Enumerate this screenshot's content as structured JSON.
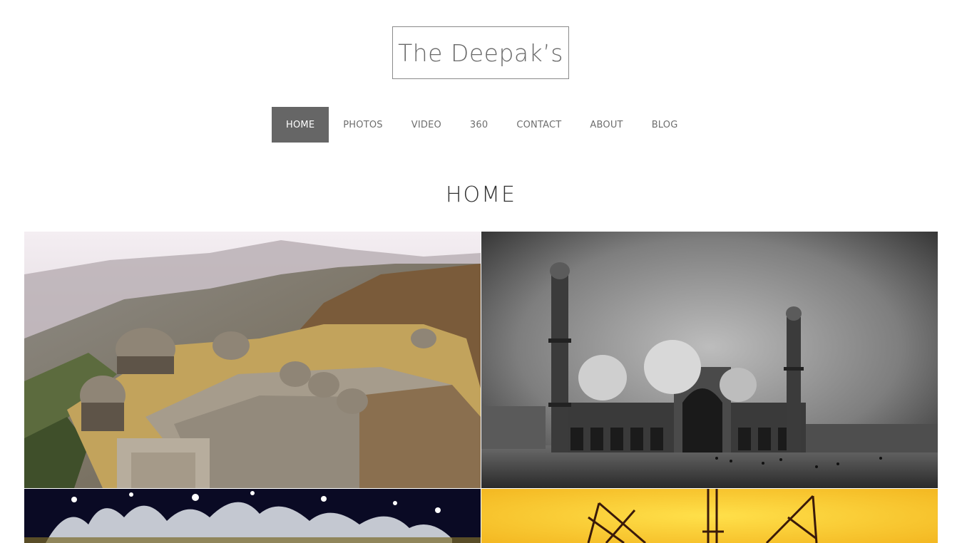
{
  "site": {
    "logo_text": "The Deepak’s"
  },
  "nav": {
    "items": [
      {
        "label": "HOME",
        "active": true
      },
      {
        "label": "PHOTOS",
        "active": false
      },
      {
        "label": "VIDEO",
        "active": false
      },
      {
        "label": "360",
        "active": false
      },
      {
        "label": "CONTACT",
        "active": false
      },
      {
        "label": "ABOUT",
        "active": false
      },
      {
        "label": "BLOG",
        "active": false
      }
    ]
  },
  "page": {
    "title": "HOME"
  },
  "gallery": {
    "tiles": [
      {
        "subject": "hilltop palace aerial view"
      },
      {
        "subject": "black and white mosque with minarets"
      },
      {
        "subject": "water splash on dark background"
      },
      {
        "subject": "electricity pylon silhouette on yellow sky"
      }
    ]
  },
  "colors": {
    "nav_active_bg": "#666666",
    "nav_text": "#6e6e6e",
    "title_text": "#333333",
    "logo_border": "#8a8a8a"
  }
}
